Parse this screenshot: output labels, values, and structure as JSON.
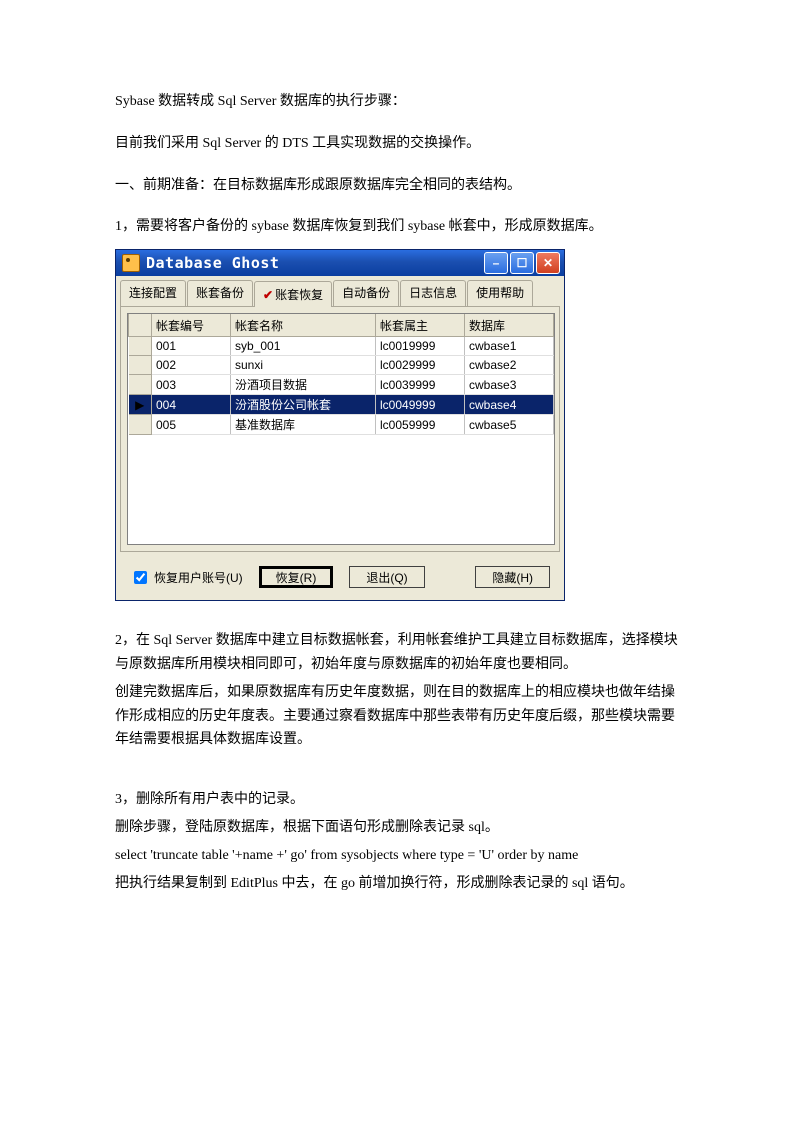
{
  "doc": {
    "title": "Sybase 数据转成 Sql Server 数据库的执行步骤：",
    "p1": "目前我们采用 Sql Server  的 DTS 工具实现数据的交换操作。",
    "p2": "一、前期准备：在目标数据库形成跟原数据库完全相同的表结构。",
    "p3": "1，需要将客户备份的 sybase 数据库恢复到我们 sybase 帐套中，形成原数据库。",
    "p4a": "2，在 Sql Server 数据库中建立目标数据帐套，利用帐套维护工具建立目标数据库，选择模块与原数据库所用模块相同即可，初始年度与原数据库的初始年度也要相同。",
    "p4b": "创建完数据库后，如果原数据库有历史年度数据，则在目的数据库上的相应模块也做年结操作形成相应的历史年度表。主要通过察看数据库中那些表带有历史年度后缀，那些模块需要年结需要根据具体数据库设置。",
    "p5a": "3，删除所有用户表中的记录。",
    "p5b": "删除步骤，登陆原数据库，根据下面语句形成删除表记录 sql。",
    "p5c": "select 'truncate table '+name +' go' from sysobjects where type = 'U' order by name",
    "p5d": "把执行结果复制到 EditPlus 中去，在 go 前增加换行符，形成删除表记录的 sql 语句。"
  },
  "window": {
    "title": "Database Ghost",
    "tabs": {
      "connect": "连接配置",
      "backup": "账套备份",
      "restore": "账套恢复",
      "auto": "自动备份",
      "log": "日志信息",
      "help": "使用帮助"
    },
    "columns": {
      "id": "帐套编号",
      "name": "帐套名称",
      "owner": "帐套属主",
      "db": "数据库"
    },
    "rows": [
      {
        "id": "001",
        "name": "syb_001",
        "owner": "lc0019999",
        "db": "cwbase1",
        "sel": false
      },
      {
        "id": "002",
        "name": "sunxi",
        "owner": "lc0029999",
        "db": "cwbase2",
        "sel": false
      },
      {
        "id": "003",
        "name": "汾酒项目数据",
        "owner": "lc0039999",
        "db": "cwbase3",
        "sel": false
      },
      {
        "id": "004",
        "name": "汾酒股份公司帐套",
        "owner": "lc0049999",
        "db": "cwbase4",
        "sel": true
      },
      {
        "id": "005",
        "name": "基准数据库",
        "owner": "lc0059999",
        "db": "cwbase5",
        "sel": false
      }
    ],
    "checkbox": "恢复用户账号(U)",
    "buttons": {
      "restore": "恢复(R)",
      "exit": "退出(Q)",
      "hide": "隐藏(H)"
    }
  }
}
